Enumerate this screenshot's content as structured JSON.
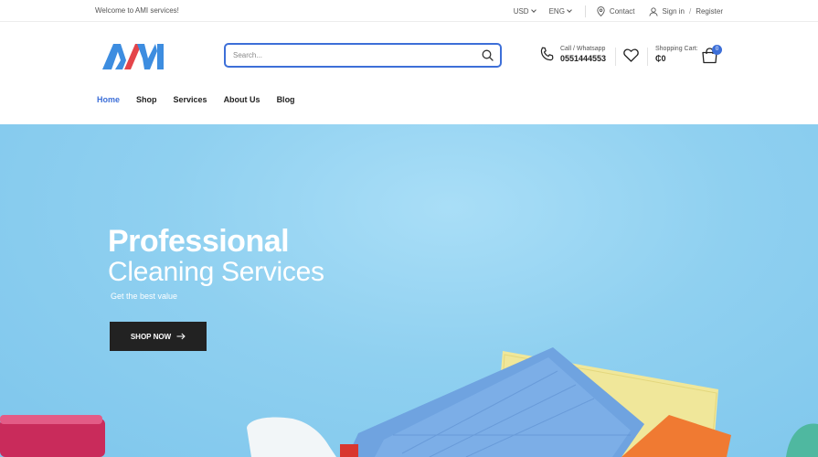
{
  "topbar": {
    "welcome": "Welcome to AMI services!",
    "currency": "USD",
    "language": "ENG",
    "contact": "Contact",
    "sign_in": "Sign in",
    "separator": "/",
    "register": "Register"
  },
  "header": {
    "logo_alt": "AMI",
    "search_placeholder": "Search...",
    "call_label": "Call / Whatsapp",
    "call_number": "0551444553",
    "cart_label": "Shopping Cart:",
    "cart_total": "₵0",
    "cart_count": "0"
  },
  "nav": [
    {
      "label": "Home",
      "active": true
    },
    {
      "label": "Shop"
    },
    {
      "label": "Services"
    },
    {
      "label": "About Us"
    },
    {
      "label": "Blog"
    }
  ],
  "hero": {
    "title_bold": "Professional",
    "title_light": "Cleaning Services",
    "subtitle": "Get the best value",
    "cta": "SHOP NOW"
  },
  "colors": {
    "accent": "#3d6fd8",
    "logo_red": "#e4444a",
    "logo_blue": "#3d8de0",
    "hero_bg": "#8fd0f0",
    "button_dark": "#222222"
  },
  "icons": {
    "search": "search-icon",
    "phone": "phone-icon",
    "wishlist": "heart-icon",
    "cart": "shopping-bag-icon",
    "contact": "location-pin-icon",
    "account": "user-icon",
    "cta_arrow": "arrow-right-icon"
  }
}
